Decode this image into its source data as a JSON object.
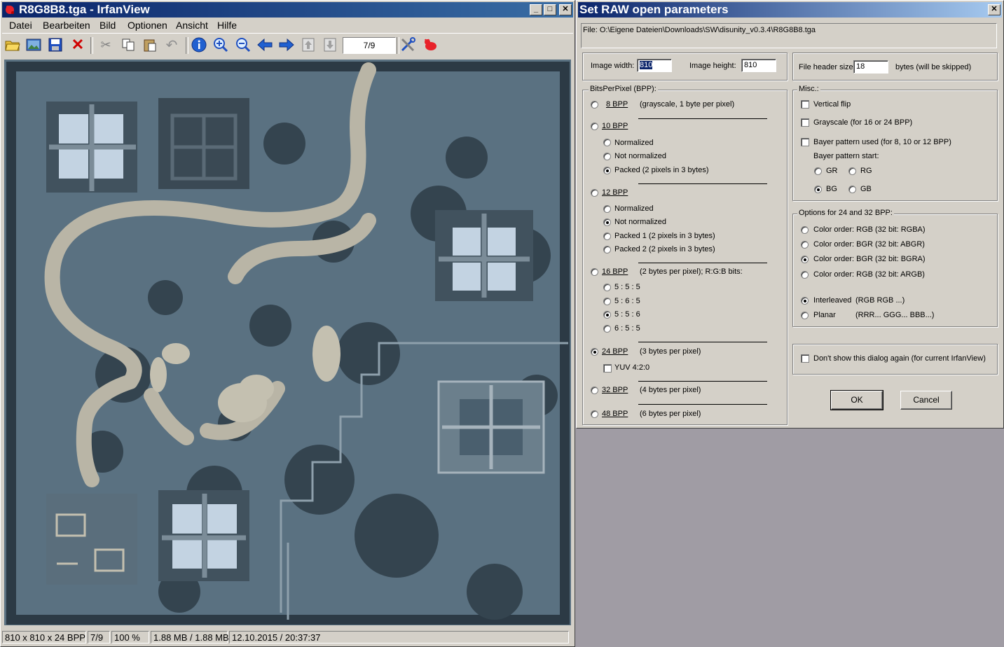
{
  "viewer": {
    "title": "R8G8B8.tga - IrfanView",
    "menus": [
      "Datei",
      "Bearbeiten",
      "Bild",
      "Optionen",
      "Ansicht",
      "Hilfe"
    ],
    "page": "7/9",
    "status": {
      "dims": "810 x 810 x 24 BPP",
      "index": "7/9",
      "zoom": "100 %",
      "size": "1.88 MB / 1.88 MB",
      "date": "12.10.2015 / 20:37:37"
    }
  },
  "dialog": {
    "title": "Set RAW open parameters",
    "file": "File: O:\\Eigene Dateien\\Downloads\\SW\\disunity_v0.3.4\\R8G8B8.tga",
    "width_label": "Image width:",
    "width_value": "810",
    "height_label": "Image height:",
    "height_value": "810",
    "header_label": "File header size:",
    "header_value": "18",
    "header_suffix": "bytes (will be skipped)",
    "bpp_group": "BitsPerPixel (BPP):",
    "bpp": {
      "b8": "8 BPP",
      "b8_desc": "(grayscale, 1 byte per pixel)",
      "b10": "10 BPP",
      "b10_norm": "Normalized",
      "b10_notnorm": "Not normalized",
      "b10_packed": "Packed (2 pixels in 3 bytes)",
      "b12": "12 BPP",
      "b12_norm": "Normalized",
      "b12_notnorm": "Not normalized",
      "b12_packed1": "Packed 1 (2 pixels in 3 bytes)",
      "b12_packed2": "Packed 2 (2 pixels in 3 bytes)",
      "b16": "16 BPP",
      "b16_desc": "(2 bytes per pixel); R:G:B bits:",
      "b16_555": "5 : 5 : 5",
      "b16_565": "5 : 6 : 5",
      "b16_556": "5 : 5 : 6",
      "b16_655": "6 : 5 : 5",
      "b24": "24 BPP",
      "b24_desc": "(3 bytes per pixel)",
      "yuv": "YUV 4:2:0",
      "b32": "32 BPP",
      "b32_desc": "(4 bytes per pixel)",
      "b48": "48 BPP",
      "b48_desc": "(6 bytes per pixel)"
    },
    "misc_group": "Misc.:",
    "misc": {
      "vflip": "Vertical flip",
      "gray": "Grayscale (for 16 or 24 BPP)",
      "bayer": "Bayer pattern used (for 8, 10 or 12 BPP)",
      "bayer_start": "Bayer pattern start:",
      "gr": "GR",
      "rg": "RG",
      "bg": "BG",
      "gb": "GB"
    },
    "opt_group": "Options for 24 and 32 BPP:",
    "opt": {
      "rgba": "Color order: RGB (32 bit: RGBA)",
      "abgr": "Color order: BGR (32 bit: ABGR)",
      "bgra": "Color order: BGR (32 bit: BGRA)",
      "argb": "Color order: RGB (32 bit: ARGB)",
      "interleaved": "Interleaved",
      "interleaved_desc": "(RGB RGB ...)",
      "planar": "Planar",
      "planar_desc": "(RRR... GGG... BBB...)"
    },
    "dontshow": "Don't show this dialog again (for current IrfanView)",
    "ok": "OK",
    "cancel": "Cancel"
  }
}
